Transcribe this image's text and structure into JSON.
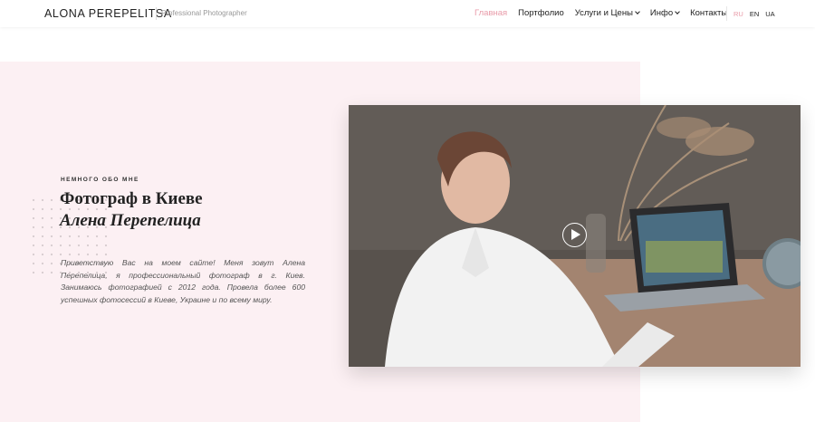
{
  "header": {
    "logo": "ALONA PEREPELITSA",
    "tagline": "Professional Photographer",
    "nav": [
      {
        "label": "Главная",
        "active": true,
        "dropdown": false
      },
      {
        "label": "Портфолио",
        "active": false,
        "dropdown": false
      },
      {
        "label": "Услуги и Цены",
        "active": false,
        "dropdown": true
      },
      {
        "label": "Инфо",
        "active": false,
        "dropdown": true
      },
      {
        "label": "Контакты",
        "active": false,
        "dropdown": false
      }
    ],
    "languages": [
      {
        "label": "RU",
        "active": true
      },
      {
        "label": "EN",
        "active": false
      },
      {
        "label": "UA",
        "active": false
      }
    ]
  },
  "hero": {
    "eyebrow": "НЕМНОГО ОБО МНЕ",
    "title_line1": "Фотограф в Киеве",
    "title_line2": "Алена Перепелица",
    "intro": "Приветствую Вас на моем сайте! Меня зовут Алена Перепелица, я профессиональный фотограф в г. Киев. Занимаюсь фотографией с 2012 года. Провела более 600 успешных фотосессий в Киеве, Украине и по всему миру."
  },
  "colors": {
    "accent": "#e89aa8",
    "hero_bg": "#fcf0f3"
  }
}
